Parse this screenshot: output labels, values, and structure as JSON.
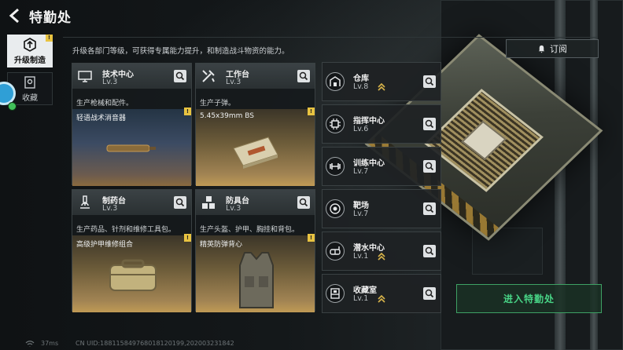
{
  "header": {
    "title": "特勤处",
    "description": "升级各部门等级，可获得专属能力提升，和制造战斗物资的能力。"
  },
  "nav": {
    "active": {
      "label": "升级制造",
      "badge": "!"
    },
    "inactive": {
      "label": "收藏"
    }
  },
  "subscribe": {
    "label": "订阅"
  },
  "departments": [
    {
      "name": "技术中心",
      "level": "Lv.3",
      "description": "生产枪械和配件。",
      "item": "轻语战术消音器",
      "badge": "!"
    },
    {
      "name": "工作台",
      "level": "Lv.3",
      "description": "生产子弹。",
      "item": "5.45x39mm BS",
      "badge": "!"
    },
    {
      "name": "制药台",
      "level": "Lv.3",
      "description": "生产药品、针剂和维修工具包。",
      "item": "高级护甲维修组合",
      "badge": "!"
    },
    {
      "name": "防具台",
      "level": "Lv.3",
      "description": "生产头盔、护甲、胸挂和背包。",
      "item": "精英防弹背心",
      "badge": "!"
    }
  ],
  "facilities": [
    {
      "name": "仓库",
      "level": "Lv.8",
      "upgradable": true
    },
    {
      "name": "指挥中心",
      "level": "Lv.6",
      "upgradable": false
    },
    {
      "name": "训练中心",
      "level": "Lv.7",
      "upgradable": false
    },
    {
      "name": "靶场",
      "level": "Lv.7",
      "upgradable": false
    },
    {
      "name": "潜水中心",
      "level": "Lv.1",
      "upgradable": true
    },
    {
      "name": "收藏室",
      "level": "Lv.1",
      "upgradable": true
    }
  ],
  "enter": {
    "label": "进入特勤处"
  },
  "footer": {
    "ping": "37ms",
    "uid": "CN UID:18811584976801812019​9,202003231842"
  },
  "colors": {
    "accent_green": "#48d486",
    "badge_yellow": "#e8c341",
    "upgrade_gold": "#d8b44a"
  }
}
